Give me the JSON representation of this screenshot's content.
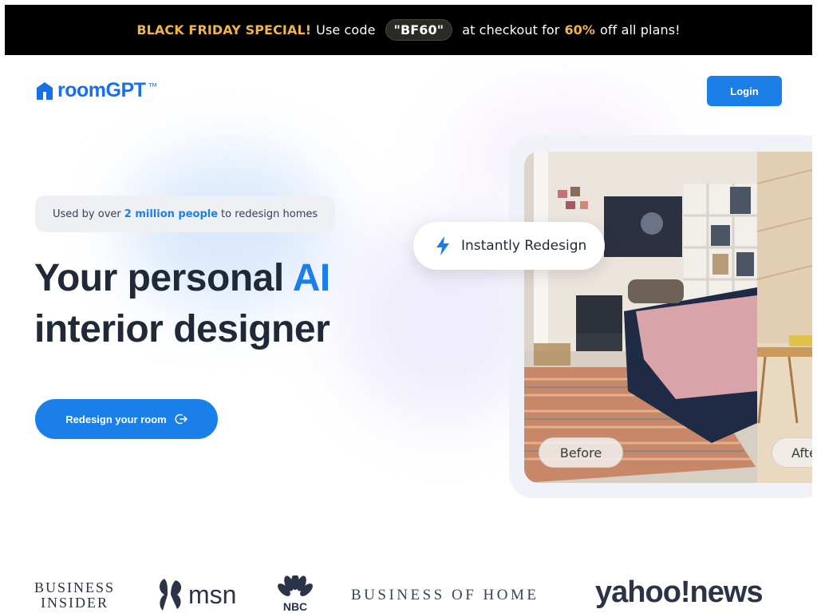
{
  "banner": {
    "promo": "BLACK FRIDAY SPECIAL!",
    "use_code": "Use code",
    "code": "\"BF60\"",
    "at_checkout": "at checkout for",
    "percent": "60%",
    "rest": "off all plans!"
  },
  "header": {
    "logo_text": "roomGPT",
    "logo_mark": "TM",
    "login_label": "Login"
  },
  "hero": {
    "pill_prefix": "Used by over",
    "pill_highlight": "2 million people",
    "pill_suffix": "to redesign homes",
    "headline_line1": "Your personal",
    "headline_ai": "AI",
    "headline_line2": "interior designer",
    "cta_label": "Redesign your room",
    "cta_icon": "arrow-out-icon"
  },
  "preview": {
    "instant_label": "Instantly Redesign",
    "instant_icon": "lightning-icon",
    "before_label": "Before",
    "after_label": "After"
  },
  "press": {
    "business_insider_line1": "BUSINESS",
    "business_insider_line2": "INSIDER",
    "msn": "msn",
    "nbc": "NBC",
    "business_of_home": "BUSINESS OF HOME",
    "yahoo": "yahoo!news"
  },
  "colors": {
    "brand_blue": "#1a7fe8",
    "banner_bg": "#000000",
    "promo_gold": "#f0b44c",
    "text_dark": "#1f2937"
  }
}
